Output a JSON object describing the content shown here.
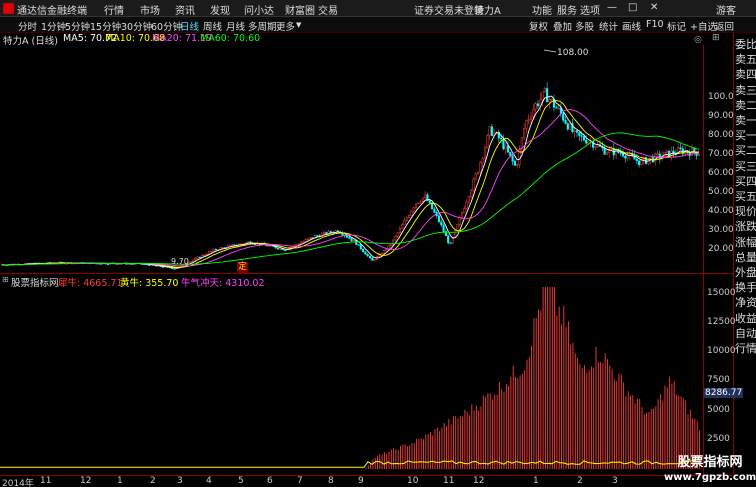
{
  "app": {
    "title": "通达信金融终端",
    "menu": [
      "行情",
      "市场",
      "资讯",
      "发现",
      "问小达",
      "财富圈",
      "交易"
    ],
    "status_notice": "证券交易未登录",
    "stock_tag": "特力A",
    "right_menu": [
      "功能",
      "服务",
      "选项"
    ],
    "guest_label": "游客"
  },
  "toolbar": {
    "periods": [
      "分时",
      "1分钟",
      "5分钟",
      "15分钟",
      "30分钟",
      "60分钟",
      "日线",
      "周线",
      "月线",
      "多周期",
      "更多"
    ],
    "active_period": "日线",
    "tools": [
      "复权",
      "叠加",
      "多股",
      "统计",
      "画线",
      "F10",
      "标记",
      "+自选",
      "返回"
    ]
  },
  "kline_header": {
    "stock": "特力A (日线)",
    "ma5": "MA5: 70.72",
    "ma10": "MA10: 70.68",
    "ma20": "MA20: 71.19",
    "ma60": "MA60: 70.60"
  },
  "price_axis": [
    "100.0",
    "90.00",
    "80.00",
    "70.00",
    "60.00",
    "50.00",
    "40.00",
    "30.00",
    "20.00"
  ],
  "annotations": {
    "high": "108.00",
    "low": "9.70",
    "marker": "定"
  },
  "sidebar": [
    "委比",
    "卖五",
    "卖四",
    "卖三",
    "卖二",
    "卖一",
    "买一",
    "买二",
    "买三",
    "买四",
    "买五",
    "现价",
    "涨跌",
    "涨幅",
    "总量",
    "外盘",
    "换手",
    "净资",
    "收益",
    "自动",
    "行情"
  ],
  "indicator": {
    "name": "股票指标网",
    "bull": "犀牛: 4665.71",
    "yellow": "黄牛: 355.70",
    "qi": "牛气冲天: 4310.02",
    "axis": [
      "15000",
      "12500",
      "10000",
      "7500",
      "5000",
      "2500"
    ],
    "current_value": "8286.77"
  },
  "date_axis": [
    "2014年",
    "11",
    "12",
    "1",
    "2",
    "3",
    "4",
    "5",
    "6",
    "7",
    "8",
    "9",
    "10",
    "11",
    "12",
    "1",
    "2",
    "3"
  ],
  "watermark": {
    "line1": "股票指标网",
    "line2": "www.7gpzb.com"
  },
  "colors": {
    "ma5": "#ffffff",
    "ma10": "#ffff00",
    "ma20": "#ff44ff",
    "ma60": "#00ff00",
    "up": "#ff3c3c",
    "down": "#00ffff"
  }
}
